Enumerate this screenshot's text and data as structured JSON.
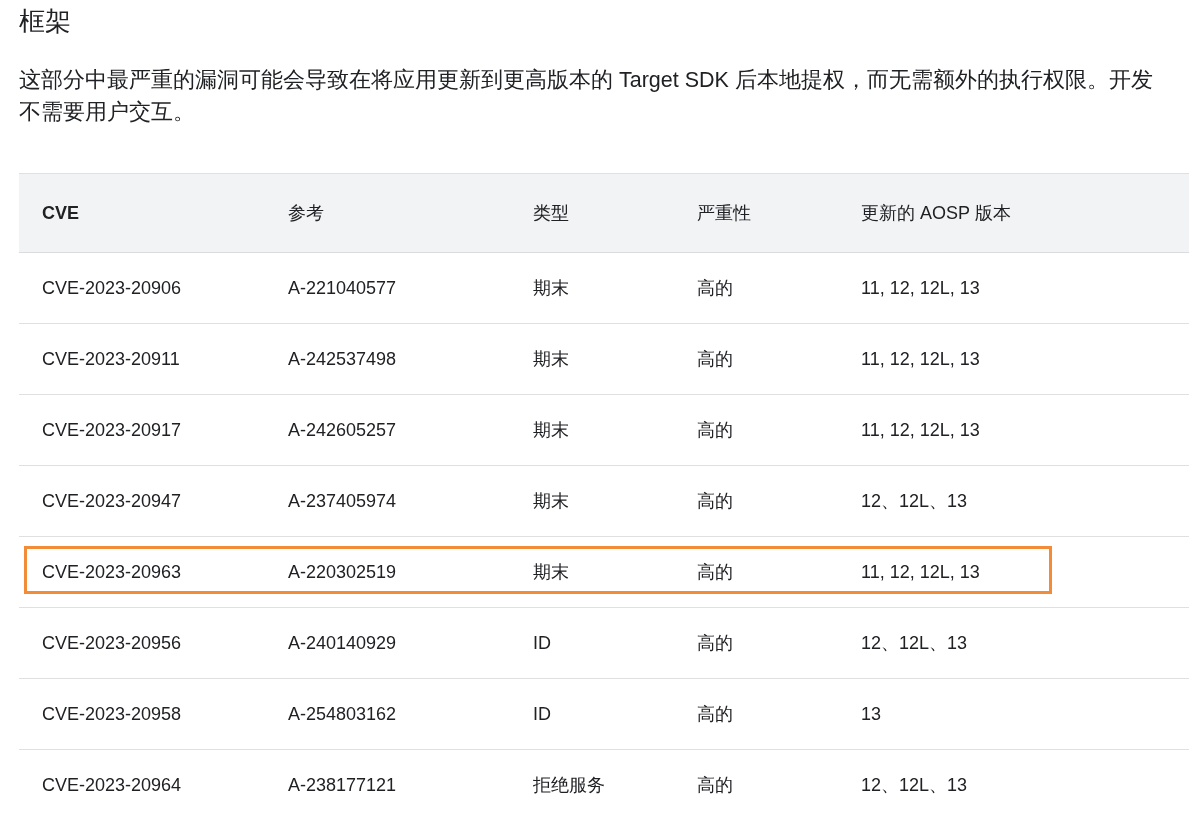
{
  "heading": "框架",
  "description": "这部分中最严重的漏洞可能会导致在将应用更新到更高版本的 Target SDK 后本地提权，而无需额外的执行权限。开发不需要用户交互。",
  "table": {
    "columns": [
      "CVE",
      "参考",
      "类型",
      "严重性",
      "更新的 AOSP 版本"
    ],
    "rows": [
      {
        "cells": [
          "CVE-2023-20906",
          "A-221040577",
          "期末",
          "高的",
          "11, 12, 12L, 13"
        ],
        "highlighted": false
      },
      {
        "cells": [
          "CVE-2023-20911",
          "A-242537498",
          "期末",
          "高的",
          "11, 12, 12L, 13"
        ],
        "highlighted": false
      },
      {
        "cells": [
          "CVE-2023-20917",
          "A-242605257",
          "期末",
          "高的",
          "11, 12, 12L, 13"
        ],
        "highlighted": false
      },
      {
        "cells": [
          "CVE-2023-20947",
          "A-237405974",
          "期末",
          "高的",
          "12、12L、13"
        ],
        "highlighted": false
      },
      {
        "cells": [
          "CVE-2023-20963",
          "A-220302519",
          "期末",
          "高的",
          "11, 12, 12L, 13"
        ],
        "highlighted": true
      },
      {
        "cells": [
          "CVE-2023-20956",
          "A-240140929",
          "ID",
          "高的",
          "12、12L、13"
        ],
        "highlighted": false
      },
      {
        "cells": [
          "CVE-2023-20958",
          "A-254803162",
          "ID",
          "高的",
          "13"
        ],
        "highlighted": false
      },
      {
        "cells": [
          "CVE-2023-20964",
          "A-238177121",
          "拒绝服务",
          "高的",
          "12、12L、13"
        ],
        "highlighted": false
      }
    ]
  }
}
